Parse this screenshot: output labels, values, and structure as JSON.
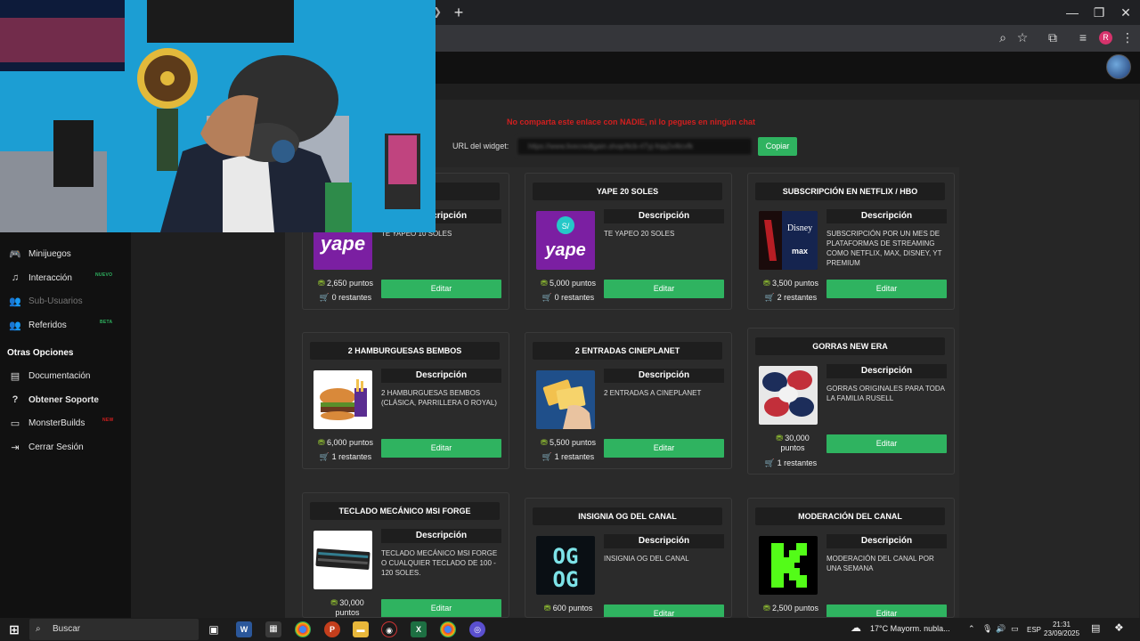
{
  "sidebar": {
    "items": [
      {
        "label": "Minijuegos",
        "icon": "gamepad-icon",
        "badge": ""
      },
      {
        "label": "Interacción",
        "icon": "music-icon",
        "badge": "NUEVO"
      },
      {
        "label": "Sub-Usuarios",
        "icon": "users-icon",
        "badge": ""
      },
      {
        "label": "Referidos",
        "icon": "referrals-icon",
        "badge": "BETA"
      }
    ],
    "heading": "Otras Opciones",
    "other": [
      {
        "label": "Documentación",
        "icon": "docs-icon",
        "badge": ""
      },
      {
        "label": "Obtener Soporte",
        "icon": "help-icon",
        "badge": ""
      },
      {
        "label": "MonsterBuilds",
        "icon": "laptop-icon",
        "badge": "NEW"
      },
      {
        "label": "Cerrar Sesión",
        "icon": "logout-icon",
        "badge": ""
      }
    ]
  },
  "widget": {
    "warning": "No comparta este enlace con NADIE, ni lo pegues en ningún chat",
    "url_label": "URL del widget:",
    "url_value": "https://www.livecredtgain.shop/ttcb-rl7yj-fnjq2x4tcvfk",
    "copy_label": "Copiar"
  },
  "cards": [
    {
      "title": "",
      "desc_head": "Descripción",
      "desc": "TE YAPEO 10 SOLES",
      "points": "2,650 puntos",
      "remaining": "0 restantes",
      "edit": "Editar",
      "img": "yape"
    },
    {
      "title": "YAPE 20 SOLES",
      "desc_head": "Descripción",
      "desc": "TE YAPEO 20 SOLES",
      "points": "5,000 puntos",
      "remaining": "0 restantes",
      "edit": "Editar",
      "img": "yape-s"
    },
    {
      "title": "SUBSCRIPCIÓN EN NETFLIX / HBO",
      "desc_head": "Descripción",
      "desc": "SUBSCRIPCIÓN POR UN MES DE PLATAFORMAS DE STREAMING COMO NETFLIX, MAX, DISNEY, YT PREMIUM",
      "points": "3,500 puntos",
      "remaining": "2 restantes",
      "edit": "Editar",
      "img": "streaming"
    },
    {
      "title": "2 HAMBURGUESAS BEMBOS",
      "desc_head": "Descripción",
      "desc": "2 HAMBURGUESAS BEMBOS (CLÁSICA, PARRILLERA O ROYAL)",
      "points": "6,000 puntos",
      "remaining": "1 restantes",
      "edit": "Editar",
      "img": "burger"
    },
    {
      "title": "2 ENTRADAS CINEPLANET",
      "desc_head": "Descripción",
      "desc": "2 ENTRADAS A CINEPLANET",
      "points": "5,500 puntos",
      "remaining": "1 restantes",
      "edit": "Editar",
      "img": "tickets"
    },
    {
      "title": "GORRAS NEW ERA",
      "desc_head": "Descripción",
      "desc": "GORRAS ORIGINALES PARA TODA LA FAMILIA RUSELL",
      "points": "30,000 puntos",
      "remaining": "1 restantes",
      "edit": "Editar",
      "img": "caps"
    },
    {
      "title": "TECLADO MECÁNICO MSI FORGE",
      "desc_head": "Descripción",
      "desc": "TECLADO MECÁNICO MSI FORGE O CUALQUIER TECLADO DE 100 - 120 SOLES.",
      "points": "30,000 puntos",
      "remaining": "",
      "edit": "Editar",
      "img": "keyboard"
    },
    {
      "title": "INSIGNIA OG DEL CANAL",
      "desc_head": "Descripción",
      "desc": "INSIGNIA OG DEL CANAL",
      "points": "600 puntos",
      "remaining": "",
      "edit": "Editar",
      "img": "og"
    },
    {
      "title": "MODERACIÓN DEL CANAL",
      "desc_head": "Descripción",
      "desc": "MODERACIÓN DEL CANAL POR UNA SEMANA",
      "points": "2,500 puntos",
      "remaining": "",
      "edit": "Editar",
      "img": "kick"
    }
  ],
  "taskbar": {
    "search": "Buscar",
    "weather": "17°C  Mayorm. nubla...",
    "lang": "ESP",
    "time": "21:31",
    "date": "23/09/2025"
  },
  "colors": {
    "accent": "#2fb360",
    "warning": "#d21f1f"
  }
}
